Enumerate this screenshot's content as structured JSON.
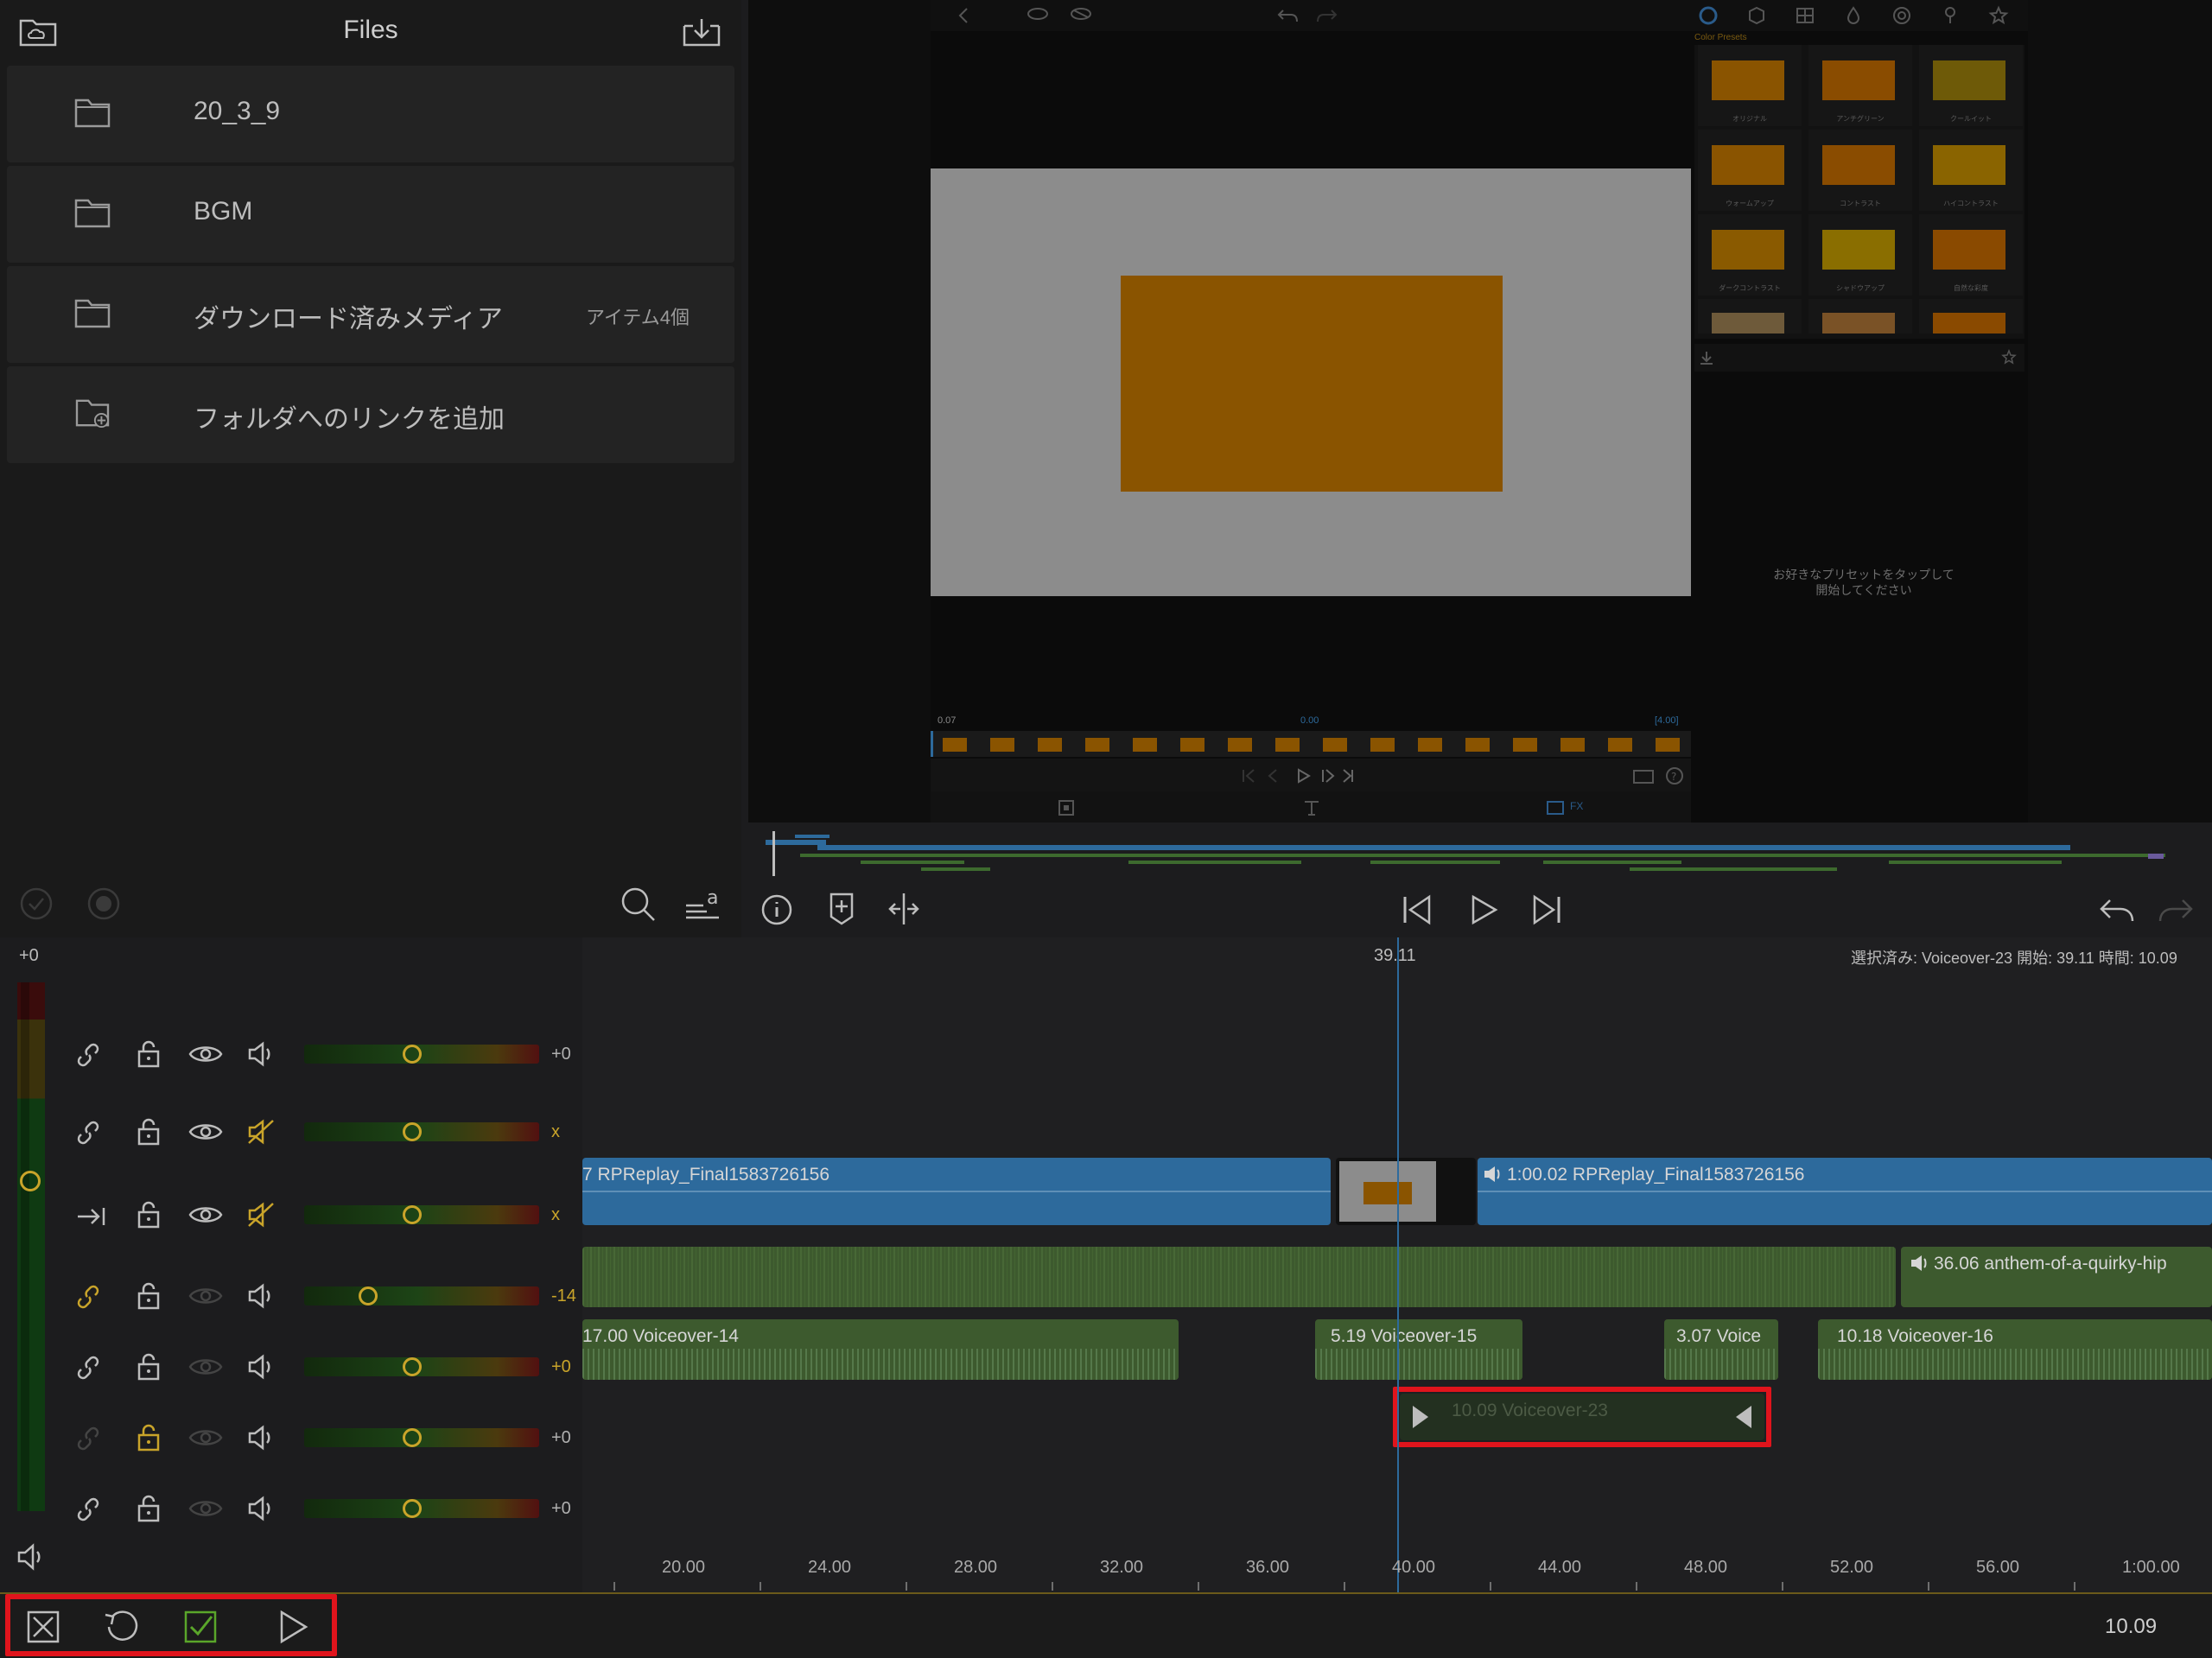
{
  "files_panel": {
    "title": "Files",
    "items": [
      {
        "label": "20_3_9",
        "count": "",
        "icon": "folder-icon"
      },
      {
        "label": "BGM",
        "count": "",
        "icon": "folder-icon"
      },
      {
        "label": "ダウンロード済みメディア",
        "count": "アイテム4個",
        "icon": "folder-icon"
      },
      {
        "label": "フォルダへのリンクを追加",
        "count": "",
        "icon": "folder-add-icon"
      }
    ]
  },
  "preview": {
    "time_left": "0.07",
    "time_mid": "0.00",
    "time_right": "[4.00]",
    "presets_title": "Color Presets",
    "preset_names": [
      "オリジナル",
      "アンチグリーン",
      "クールイット",
      "ウォームアップ",
      "コントラスト",
      "ハイコントラスト",
      "ダークコントラスト",
      "シャドウアップ",
      "自然な彩度"
    ],
    "hint_line1": "お好きなプリセットをタップして",
    "hint_line2": "開始してください",
    "fx_label": "FX"
  },
  "timeline": {
    "playhead_time": "39.11",
    "selection_info": "選択済み: Voiceover-23 開始: 39.11 時間: 10.09",
    "master_level": "+0",
    "tracks": [
      {
        "value": "+0",
        "value_color": "#b0b0b0",
        "knob": 0.42
      },
      {
        "value": "x",
        "value_color": "#c9a42a",
        "knob": 0.42
      },
      {
        "value": "x",
        "value_color": "#c9a42a",
        "knob": 0.42
      },
      {
        "value": "-14",
        "value_color": "#c9a42a",
        "knob": 0.23
      },
      {
        "value": "+0",
        "value_color": "#c9a42a",
        "knob": 0.42
      },
      {
        "value": "+0",
        "value_color": "#b0b0b0",
        "knob": 0.42
      },
      {
        "value": "+0",
        "value_color": "#b0b0b0",
        "knob": 0.42
      }
    ],
    "clips": {
      "video_a": "7  RPReplay_Final1583726156",
      "video_b": "1:00.02  RPReplay_Final1583726156",
      "music": "36.06  anthem-of-a-quirky-hip",
      "vo14": "17.00  Voiceover-14",
      "vo15": "5.19  Voiceover-15",
      "vo_short": "3.07  Voice",
      "vo16": "10.18  Voiceover-16",
      "vo23": "10.09  Voiceover-23"
    },
    "ruler": [
      "20.00",
      "24.00",
      "28.00",
      "32.00",
      "36.00",
      "40.00",
      "44.00",
      "48.00",
      "52.00",
      "56.00",
      "1:00.00"
    ]
  },
  "bottom_bar": {
    "duration": "10.09"
  }
}
